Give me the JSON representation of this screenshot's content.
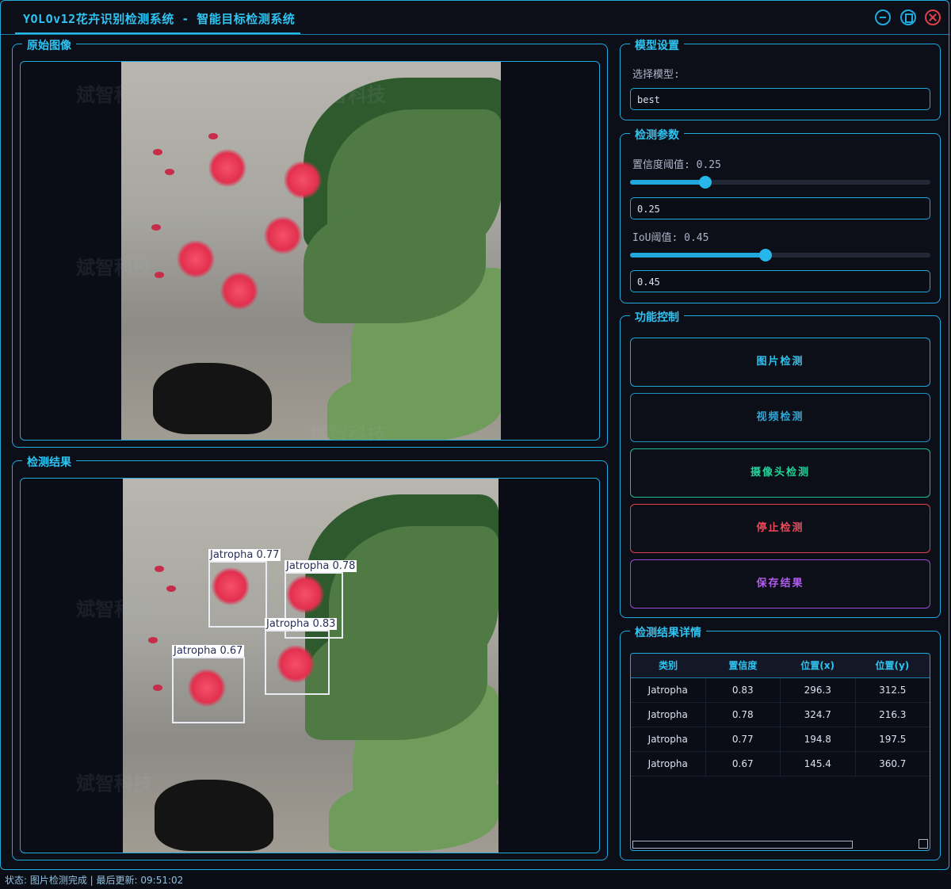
{
  "window": {
    "title": "YOLOv12花卉识别检测系统 - 智能目标检测系统"
  },
  "panels": {
    "original": {
      "title": "原始图像"
    },
    "result": {
      "title": "检测结果"
    }
  },
  "watermark": "斌智科技",
  "detections": [
    {
      "label": "Jatropha 0.77"
    },
    {
      "label": "Jatropha 0.78"
    },
    {
      "label": "Jatropha 0.83"
    },
    {
      "label": "Jatropha 0.67"
    }
  ],
  "model": {
    "title": "模型设置",
    "select_label": "选择模型:",
    "selected": "best"
  },
  "params": {
    "title": "检测参数",
    "conf_label": "置信度阈值: 0.25",
    "conf_value": "0.25",
    "conf_level": 0.25,
    "iou_label": "IoU阈值: 0.45",
    "iou_value": "0.45",
    "iou_level": 0.45
  },
  "controls": {
    "title": "功能控制",
    "image_detect": "图片检测",
    "video_detect": "视频检测",
    "camera_detect": "摄像头检测",
    "stop_detect": "停止检测",
    "save_result": "保存结果"
  },
  "details": {
    "title": "检测结果详情",
    "columns": [
      "类别",
      "置信度",
      "位置(x)",
      "位置(y)"
    ],
    "rows": [
      [
        "Jatropha",
        "0.83",
        "296.3",
        "312.5"
      ],
      [
        "Jatropha",
        "0.78",
        "324.7",
        "216.3"
      ],
      [
        "Jatropha",
        "0.77",
        "194.8",
        "197.5"
      ],
      [
        "Jatropha",
        "0.67",
        "145.4",
        "360.7"
      ]
    ]
  },
  "status": {
    "text": "状态: 图片检测完成 | 最后更新: 09:51:02"
  },
  "colors": {
    "accent": "#1fa9dc",
    "title": "#2ec4f2",
    "stop": "#e0404a",
    "save": "#9a4ad8",
    "camera": "#1fbf8a"
  }
}
